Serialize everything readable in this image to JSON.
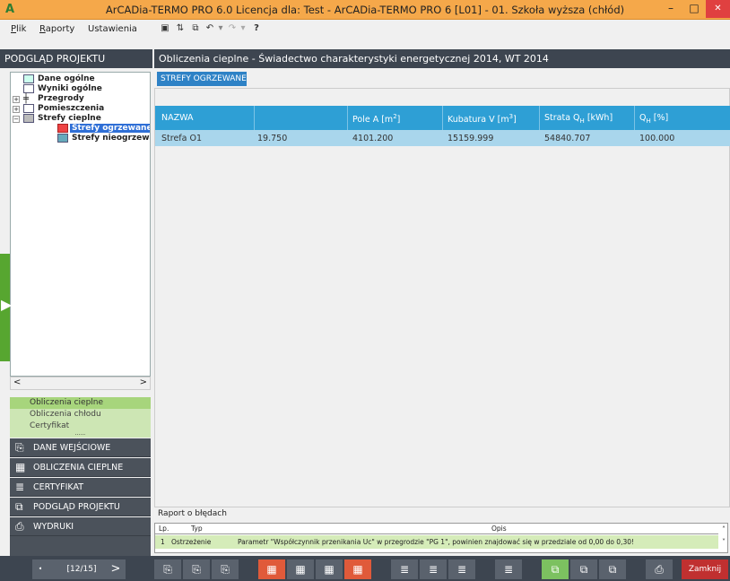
{
  "window": {
    "title": "ArCADia-TERMO PRO 6.0 Licencja dla: Test - ArCADia-TERMO PRO 6 [L01] - 01. Szkoła wyższa (chłód)"
  },
  "menu": {
    "plik_rest": "lik",
    "raporty_rest": "aporty",
    "ustawienia": "Ustawienia",
    "help": "?"
  },
  "left": {
    "header": "PODGLĄD PROJEKTU",
    "tree": [
      "Dane ogólne",
      "Wyniki ogólne",
      "Przegrody",
      "Pomieszczenia",
      "Strefy cieplne",
      "Strefy ogrzewane",
      "Strefy nieogrzewa"
    ],
    "nav_small": [
      "Obliczenia cieplne",
      "Obliczenia chłodu",
      "Certyfikat"
    ],
    "nav_dots": "......",
    "nav_big": [
      "DANE WEJŚCIOWE",
      "OBLICZENIA CIEPLNE",
      "CERTYFIKAT",
      "PODGLĄD PROJEKTU",
      "WYDRUKI"
    ],
    "hscroll_left": "<",
    "hscroll_right": ">"
  },
  "main": {
    "header": "Obliczenia cieplne - Świadectwo charakterystyki energetycznej 2014, WT 2014",
    "tab": "STREFY OGRZEWANE",
    "columns": [
      "NAZWA",
      "",
      "Pole A [m",
      "Kubatura V [m",
      "Strata Q",
      "Q"
    ],
    "col_sup": [
      "",
      "",
      "2",
      "3",
      "",
      ""
    ],
    "col_sub": [
      "",
      "",
      "",
      "",
      "H",
      "H"
    ],
    "col_suffix": [
      "",
      "",
      "]",
      "]",
      " [kWh]",
      " [%]"
    ],
    "row": [
      "Strefa O1",
      "19.750",
      "4101.200",
      "15159.999",
      "54840.707",
      "100.000"
    ]
  },
  "errors": {
    "title": "Raport o błędach",
    "headers": [
      "Lp.",
      "Typ",
      "Opis"
    ],
    "row": [
      "1",
      "Ostrzeżenie",
      "Parametr \"Współczynnik przenikania Uc\" w przegrodzie \"PG 1\", powinien znajdować się w przedziale od 0,00 do 0,30!"
    ]
  },
  "bottom": {
    "page": "[12/15]",
    "close": "Zamknij",
    "prev": "<",
    "next": ">"
  },
  "colors": {
    "accent": "#2e9fd5",
    "title_bar": "#f5a84a",
    "dark": "#3d4550",
    "green": "#57a630",
    "close": "#c03030"
  }
}
